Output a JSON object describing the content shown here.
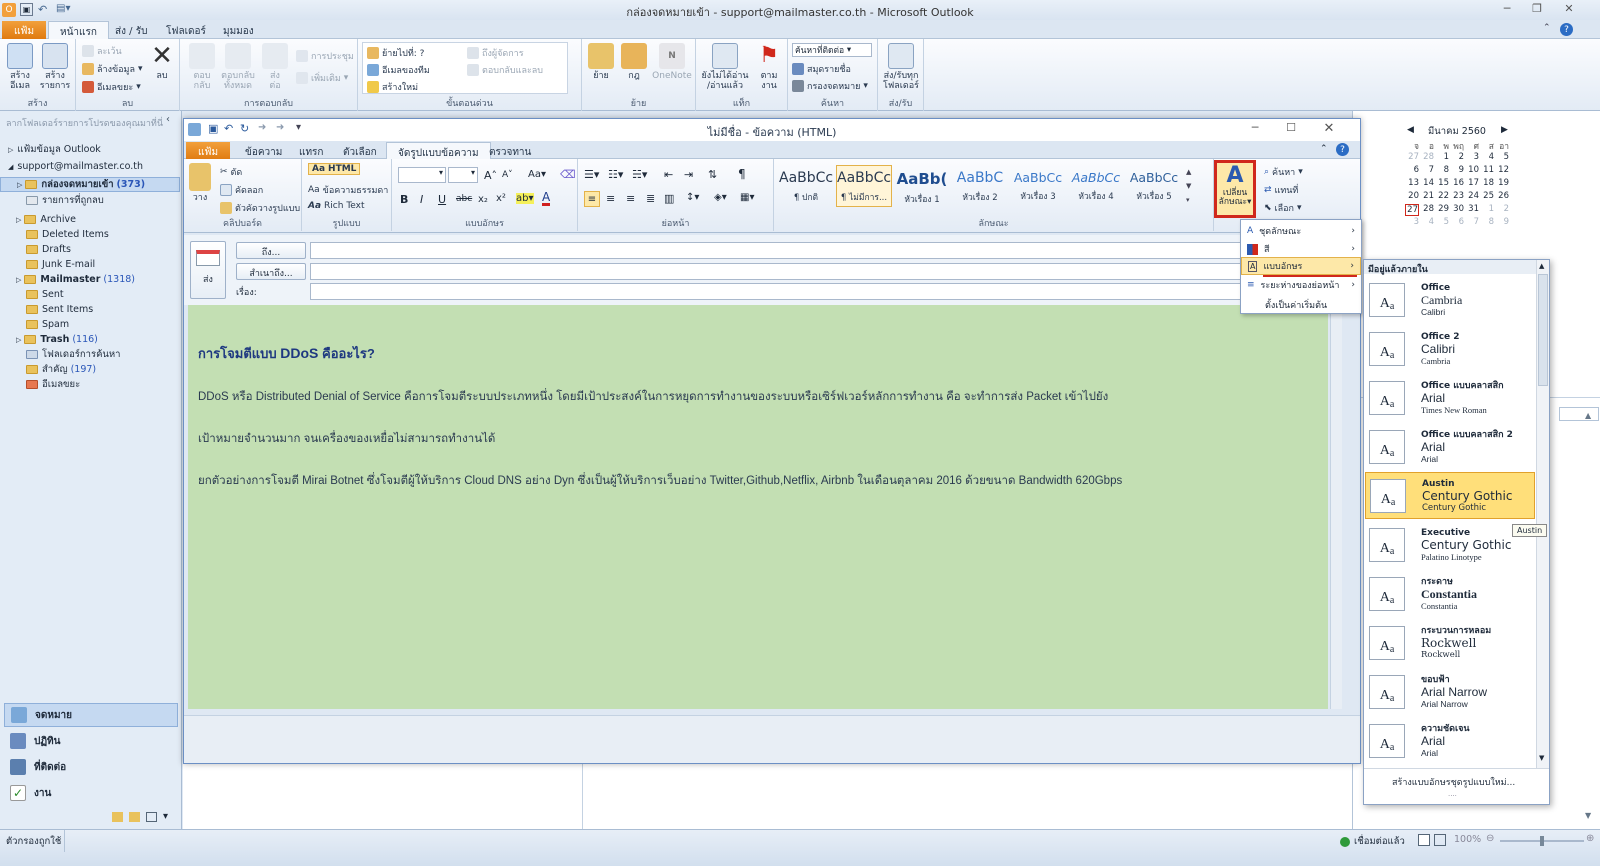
{
  "app": {
    "window_title": "กล่องจดหมายเข้า - support@mailmaster.co.th - Microsoft Outlook",
    "tabs": [
      "แฟ้ม",
      "หน้าแรก",
      "ส่ง / รับ",
      "โฟลเดอร์",
      "มุมมอง"
    ],
    "ribbon": {
      "new_group": {
        "label": "สร้าง",
        "new_email": "สร้าง\nอีเมล",
        "new_items": "สร้าง\nรายการ"
      },
      "delete_group": {
        "label": "ลบ",
        "ignore": "ละเว้น",
        "cleanup": "ล้างข้อมูล",
        "junk": "อีเมลขยะ",
        "delete": "ลบ"
      },
      "respond_group": {
        "label": "การตอบกลับ",
        "reply": "ตอบ\nกลับ",
        "reply_all": "ตอบกลับ\nทั้งหมด",
        "forward": "ส่ง\nต่อ",
        "meeting": "การประชุม",
        "more": "เพิ่มเติม"
      },
      "quick_steps": {
        "label": "ขั้นตอนด่วน",
        "move_to": "ย้ายไปที่: ?",
        "to_manager": "ถึงผู้จัดการ",
        "team_email": "อีเมลของทีม",
        "reply_delete": "ตอบกลับและลบ",
        "create_new": "สร้างใหม่"
      },
      "move_group": {
        "label": "ย้าย",
        "move": "ย้าย",
        "rules": "กฎ",
        "onenote": "OneNote"
      },
      "tags_group": {
        "label": "แท็ก",
        "unread": "ยังไม่ได้อ่าน\n/อ่านแล้ว",
        "follow": "ตาม\nงาน"
      },
      "find_group": {
        "label": "ค้นหา",
        "find_contact": "ค้นหาที่ติดต่อ",
        "address_book": "สมุดรายชื่อ",
        "filter": "กรองจดหมาย"
      },
      "sendrecv_group": {
        "label": "ส่ง/รับ",
        "send_all": "ส่ง/รับทุก\nโฟลเดอร์"
      }
    }
  },
  "nav": {
    "header": "ลากโฟลเดอร์รายการโปรดของคุณมาที่นี่",
    "items": [
      {
        "label": "แฟ้มข้อมูล Outlook",
        "count": ""
      },
      {
        "label": "support@mailmaster.co.th",
        "count": ""
      },
      {
        "label": "กล่องจดหมายเข้า",
        "count": "(373)"
      },
      {
        "label": "รายการที่ถูกลบ",
        "count": ""
      },
      {
        "label": "Archive",
        "count": ""
      },
      {
        "label": "Deleted Items",
        "count": ""
      },
      {
        "label": "Drafts",
        "count": ""
      },
      {
        "label": "Junk E-mail",
        "count": ""
      },
      {
        "label": "Mailmaster",
        "count": "(1318)"
      },
      {
        "label": "Sent",
        "count": ""
      },
      {
        "label": "Sent Items",
        "count": ""
      },
      {
        "label": "Spam",
        "count": ""
      },
      {
        "label": "Trash",
        "count": "(116)"
      },
      {
        "label": "โฟลเดอร์การค้นหา",
        "count": ""
      },
      {
        "label": "สำคัญ",
        "count": "(197)"
      },
      {
        "label": "อีเมลขยะ",
        "count": ""
      }
    ],
    "bottom": [
      "จดหมาย",
      "ปฏิทิน",
      "ที่ติดต่อ",
      "งาน"
    ]
  },
  "calendar": {
    "month": "มีนาคม 2560",
    "weekdays": [
      "จ",
      "อ",
      "พ",
      "พฤ",
      "ศ",
      "ส",
      "อา"
    ],
    "weeks": [
      [
        "27",
        "28",
        "1",
        "2",
        "3",
        "4",
        "5"
      ],
      [
        "6",
        "7",
        "8",
        "9",
        "10",
        "11",
        "12"
      ],
      [
        "13",
        "14",
        "15",
        "16",
        "17",
        "18",
        "19"
      ],
      [
        "20",
        "21",
        "22",
        "23",
        "24",
        "25",
        "26"
      ],
      [
        "27",
        "28",
        "29",
        "30",
        "31",
        "1",
        "2"
      ],
      [
        "3",
        "4",
        "5",
        "6",
        "7",
        "8",
        "9"
      ]
    ]
  },
  "status": {
    "left": "ตัวกรองถูกใช้",
    "connection": "เชื่อมต่อแล้ว",
    "zoom": "100%"
  },
  "compose": {
    "title": "ไม่มีชื่อ - ข้อความ (HTML)",
    "tabs": [
      "แฟ้ม",
      "ข้อความ",
      "แทรก",
      "ตัวเลือก",
      "จัดรูปแบบข้อความ",
      "ตรวจทาน"
    ],
    "ribbon": {
      "clipboard": {
        "label": "คลิปบอร์ด",
        "paste": "วาง",
        "cut": "ตัด",
        "copy": "คัดลอก",
        "painter": "ตัวคัดวางรูปแบบ"
      },
      "format": {
        "label": "รูปแบบ",
        "html": "HTML",
        "plain": "ข้อความธรรมดา",
        "rich": "Rich Text"
      },
      "font": {
        "label": "แบบอักษร"
      },
      "paragraph": {
        "label": "ย่อหน้า"
      },
      "styles": {
        "label": "ลักษณะ",
        "items": [
          {
            "preview": "AaBbCc",
            "name": "¶ ปกติ"
          },
          {
            "preview": "AaBbCc",
            "name": "¶ ไม่มีการ..."
          },
          {
            "preview": "AaBb(",
            "name": "หัวเรื่อง 1"
          },
          {
            "preview": "AaBbC",
            "name": "หัวเรื่อง 2"
          },
          {
            "preview": "AaBbCc",
            "name": "หัวเรื่อง 3"
          },
          {
            "preview": "AaBbCc",
            "name": "หัวเรื่อง 4"
          },
          {
            "preview": "AaBbCc",
            "name": "หัวเรื่อง 5"
          }
        ],
        "change_styles": "เปลี่ยน\nลักษณะ"
      },
      "editing": {
        "find": "ค้นหา",
        "replace": "แทนที่",
        "select": "เลือก"
      }
    },
    "fields": {
      "send": "ส่ง",
      "to": "ถึง...",
      "cc": "สำเนาถึง...",
      "subject": "เรื่อง:"
    },
    "body": {
      "heading_prefix": "การโจมตีแบบ ",
      "heading_bold": "DDoS",
      "heading_suffix": " คืออะไร?",
      "p1": "DDoS หรือ Distributed Denial of Service คือการโจมตีระบบประเภทหนึ่ง โดยมีเป้าประสงค์ในการหยุดการทำงานของระบบหรือเซิร์ฟเวอร์หลักการทำงาน คือ จะทำการส่ง Packet เข้าไปยัง",
      "p2": "เป้าหมายจำนวนมาก จนเครื่องของเหยื่อไม่สามารถทำงานได้",
      "p3": "ยกตัวอย่างการโจมตี Mirai Botnet ซึ่งโจมตีผู้ให้บริการ Cloud DNS อย่าง Dyn ซึ่งเป็นผู้ให้บริการเว็บอย่าง Twitter,Github,Netflix, Airbnb ในเดือนตุลาคม 2016 ด้วยขนาด Bandwidth 620Gbps"
    }
  },
  "change_styles_menu": [
    "ชุดลักษณะ",
    "สี",
    "แบบอักษร",
    "ระยะห่างของย่อหน้า",
    "ตั้งเป็นค่าเริ่มต้น"
  ],
  "fonts_menu": {
    "header": "มีอยู่แล้วภายใน",
    "items": [
      {
        "name": "Office",
        "heading": "Cambria",
        "body": "Calibri"
      },
      {
        "name": "Office 2",
        "heading": "Calibri",
        "body": "Cambria"
      },
      {
        "name": "Office แบบคลาสสิก",
        "heading": "Arial",
        "body": "Times New Roman"
      },
      {
        "name": "Office แบบคลาสสิก 2",
        "heading": "Arial",
        "body": "Arial"
      },
      {
        "name": "Austin",
        "heading": "Century Gothic",
        "body": "Century Gothic"
      },
      {
        "name": "Executive",
        "heading": "Century Gothic",
        "body": "Palatino Linotype"
      },
      {
        "name": "กระดาษ",
        "heading": "Constantia",
        "body": "Constantia"
      },
      {
        "name": "กระบวนการหลอม",
        "heading": "Rockwell",
        "body": "Rockwell"
      },
      {
        "name": "ขอบฟ้า",
        "heading": "Arial Narrow",
        "body": "Arial Narrow"
      },
      {
        "name": "ความชัดเจน",
        "heading": "Arial",
        "body": "Arial"
      }
    ],
    "tooltip": "Austin",
    "create": "สร้างแบบอักษรชุดรูปแบบใหม่..."
  },
  "colors": {
    "accent": "#e07a10",
    "highlight": "#ffdf7a",
    "body_bg": "#c3dfb3",
    "link": "#2a56b8"
  }
}
